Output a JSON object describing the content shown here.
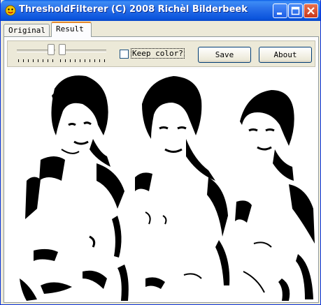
{
  "window": {
    "title": "ThresholdFilterer (C) 2008 Richèl Bilderbeek",
    "app_icon": "app-icon",
    "controls": [
      "minimize-icon",
      "maximize-icon",
      "close-icon"
    ]
  },
  "tabs": [
    {
      "label": "Original",
      "selected": false
    },
    {
      "label": "Result",
      "selected": true
    }
  ],
  "toolbar": {
    "keep_color_label": "Keep color?",
    "keep_color_checked": false,
    "save_label": "Save",
    "about_label": "About"
  },
  "colors": {
    "titlebar": "#0b55dd",
    "window_bg": "#ece9d8",
    "close_button": "#c9381c",
    "tab_highlight": "#e68b2c"
  }
}
